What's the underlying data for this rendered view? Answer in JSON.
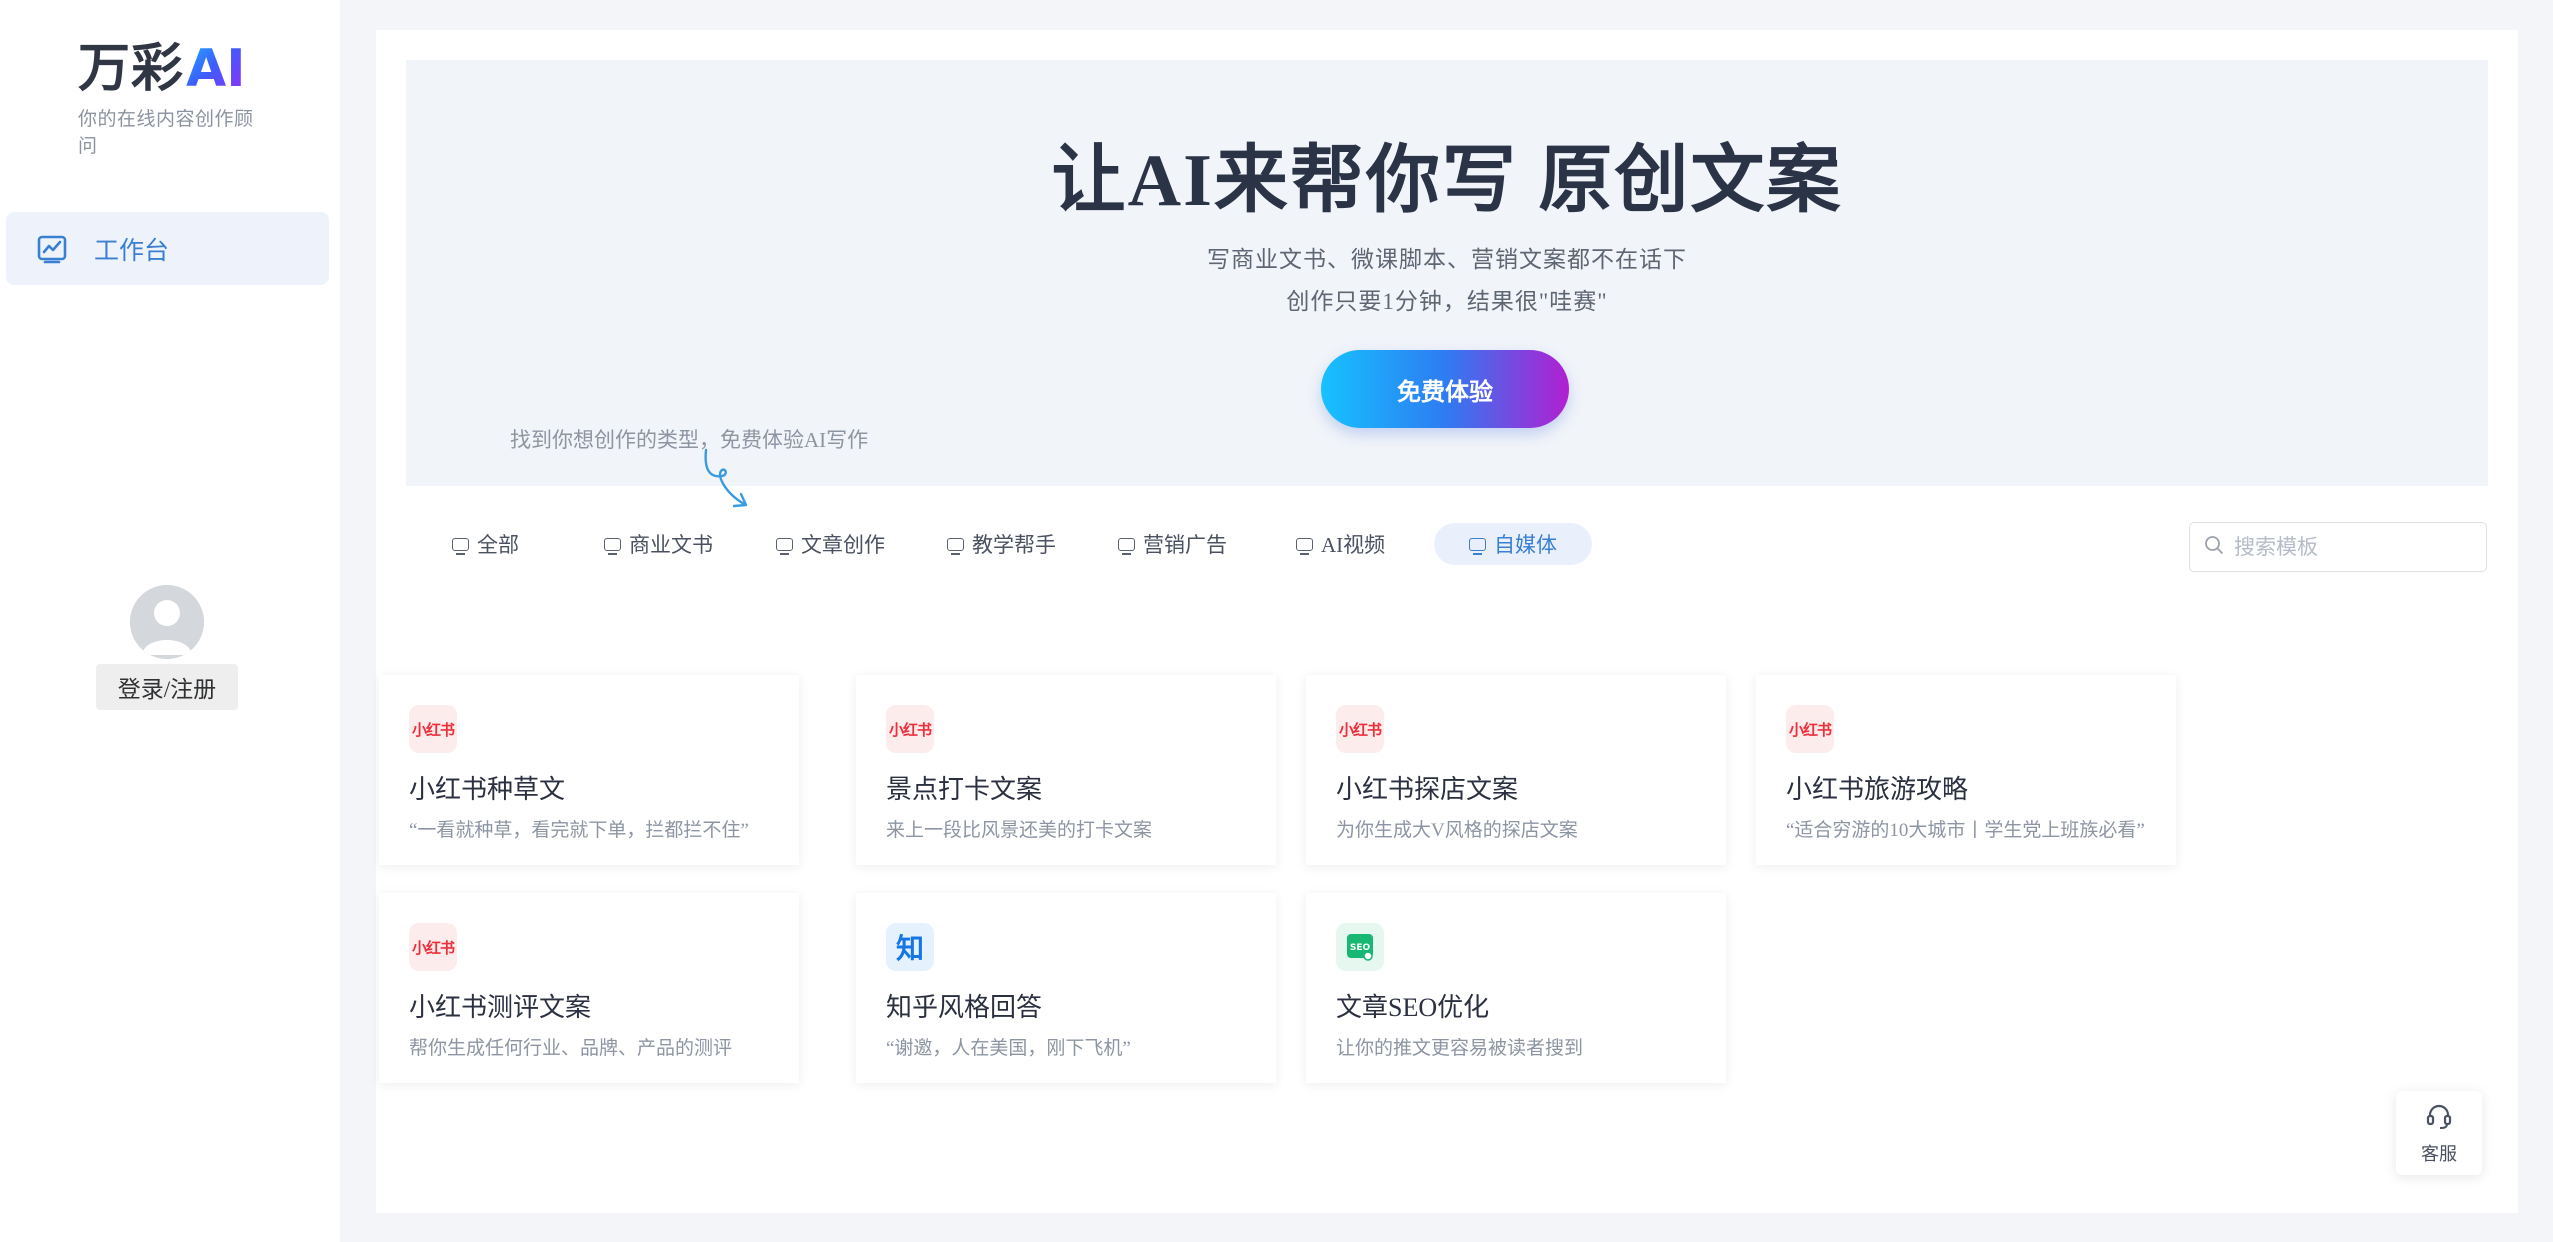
{
  "brand": {
    "logo_cn": "万彩",
    "logo_ai": "AI",
    "tagline": "你的在线内容创作顾问"
  },
  "sidebar": {
    "items": [
      {
        "label": "工作台",
        "icon": "chart-line-icon",
        "active": true
      }
    ],
    "login_label": "登录/注册"
  },
  "hero": {
    "title": "让AI来帮你写 原创文案",
    "subtitle_line1": "写商业文书、微课脚本、营销文案都不在话下",
    "subtitle_line2": "创作只要1分钟，结果很\"哇赛\"",
    "cta_label": "免费体验",
    "hint": "找到你想创作的类型，免费体验AI写作"
  },
  "tabs": [
    {
      "label": "全部"
    },
    {
      "label": "商业文书"
    },
    {
      "label": "文章创作"
    },
    {
      "label": "教学帮手"
    },
    {
      "label": "营销广告"
    },
    {
      "label": "AI视频"
    },
    {
      "label": "自媒体",
      "active": true
    }
  ],
  "search": {
    "placeholder": "搜索模板",
    "value": ""
  },
  "cards": [
    {
      "icon": "xiaohongshu-icon",
      "icon_text": "小红书",
      "title": "小红书种草文",
      "desc": "“一看就种草，看完就下单，拦都拦不住”"
    },
    {
      "icon": "xiaohongshu-icon",
      "icon_text": "小红书",
      "title": "景点打卡文案",
      "desc": "来上一段比风景还美的打卡文案"
    },
    {
      "icon": "xiaohongshu-icon",
      "icon_text": "小红书",
      "title": "小红书探店文案",
      "desc": "为你生成大V风格的探店文案"
    },
    {
      "icon": "xiaohongshu-icon",
      "icon_text": "小红书",
      "title": "小红书旅游攻略",
      "desc": "“适合穷游的10大城市丨学生党上班族必看”"
    },
    {
      "icon": "xiaohongshu-icon",
      "icon_text": "小红书",
      "title": "小红书测评文案",
      "desc": "帮你生成任何行业、品牌、产品的测评"
    },
    {
      "icon": "zhihu-icon",
      "icon_text": "知",
      "title": "知乎风格回答",
      "desc": "“谢邀，人在美国，刚下飞机”"
    },
    {
      "icon": "seo-icon",
      "icon_text": "SEO",
      "title": "文章SEO优化",
      "desc": "让你的推文更容易被读者搜到"
    }
  ],
  "service": {
    "label": "客服"
  },
  "colors": {
    "accent": "#3a7fd1",
    "xiaohongshu_red": "#ee2f3b",
    "zhihu_blue": "#1577e6",
    "seo_green": "#16b873"
  }
}
